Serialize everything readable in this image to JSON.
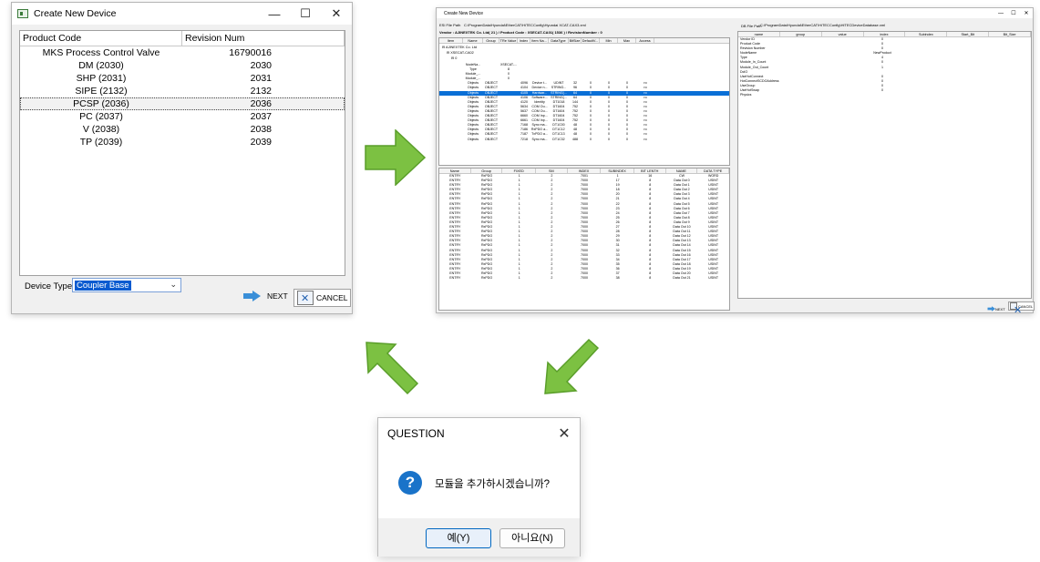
{
  "window1": {
    "title": "Create New Device",
    "columns": [
      "Product Code",
      "Revision Num"
    ],
    "rows": [
      {
        "code": "MKS Process Control Valve",
        "rev": "16790016"
      },
      {
        "code": "DM (2030)",
        "rev": "2030"
      },
      {
        "code": "SHP (2031)",
        "rev": "2031"
      },
      {
        "code": "SIPE (2132)",
        "rev": "2132"
      },
      {
        "code": "PCSP (2036)",
        "rev": "2036"
      },
      {
        "code": "PC (2037)",
        "rev": "2037"
      },
      {
        "code": "V (2038)",
        "rev": "2038"
      },
      {
        "code": "TP (2039)",
        "rev": "2039"
      }
    ],
    "selected_row": 4,
    "device_type_label": "Device Type",
    "device_type_value": "Coupler Base",
    "next_label": "NEXT",
    "cancel_label": "CANCEL"
  },
  "window2": {
    "title": "Create New Device",
    "esi_file_path_label": "ESI File Path",
    "esi_file_path": "C:\\ProgramData\\Hyundai\\EtherCAT\\HiTECConfig\\Hyundai XCAT-CAX3.xml",
    "vendor_line": "Vendor : AJINEXTEK Co. Ltd( 21 ) / Product Code : XSECAT-CA01( 1536 ) / RevisionNumber : 0",
    "tree": [
      "AJINEXTEK Co. Ltd",
      "XSECAT-CA02",
      "0"
    ],
    "grid_columns": [
      "Item",
      "Name",
      "Group",
      "TRe Value",
      "Index",
      "Item Na...",
      "DataType",
      "BitSize",
      "DefaultV...",
      "Min",
      "Max",
      "Access"
    ],
    "grid_rows": [
      [
        "",
        "NodeNa...",
        "",
        "XSECAT-...",
        "",
        "",
        "",
        "",
        "",
        "",
        "",
        ""
      ],
      [
        "",
        "Type",
        "",
        "8",
        "",
        "",
        "",
        "",
        "",
        "",
        "",
        ""
      ],
      [
        "",
        "Module_...",
        "",
        "0",
        "",
        "",
        "",
        "",
        "",
        "",
        "",
        ""
      ],
      [
        "",
        "Module_...",
        "",
        "0",
        "",
        "",
        "",
        "",
        "",
        "",
        "",
        ""
      ],
      [
        "",
        "Objects",
        "OBJECT",
        "",
        "4096",
        "Device t...",
        "UDINT",
        "32",
        "0",
        "0",
        "0",
        "ro"
      ],
      [
        "",
        "Objects",
        "OBJECT",
        "",
        "4104",
        "Device n...",
        "STRING...",
        "96",
        "0",
        "0",
        "0",
        "ro"
      ],
      [
        "",
        "Objects",
        "OBJECT",
        "",
        "4105",
        "Hardwar...",
        "STRING(...",
        "64",
        "0",
        "0",
        "0",
        "ro"
      ],
      [
        "",
        "Objects",
        "OBJECT",
        "",
        "4106",
        "Software...",
        "STRING(...",
        "64",
        "0",
        "0",
        "0",
        "ro"
      ],
      [
        "",
        "Objects",
        "OBJECT",
        "",
        "4120",
        "Identity",
        "DT1018",
        "144",
        "0",
        "0",
        "0",
        "ro"
      ],
      [
        "",
        "Objects",
        "OBJECT",
        "",
        "5634",
        "COM Ou...",
        "DT1604",
        "752",
        "0",
        "0",
        "0",
        "ro"
      ],
      [
        "",
        "Objects",
        "OBJECT",
        "",
        "5637",
        "COM Ou...",
        "DT1604",
        "752",
        "0",
        "0",
        "0",
        "ro"
      ],
      [
        "",
        "Objects",
        "OBJECT",
        "",
        "6660",
        "COM Inp...",
        "DT1604",
        "752",
        "0",
        "0",
        "0",
        "ro"
      ],
      [
        "",
        "Objects",
        "OBJECT",
        "",
        "6661",
        "COM Inp...",
        "DT1604",
        "752",
        "0",
        "0",
        "0",
        "ro"
      ],
      [
        "",
        "Objects",
        "OBJECT",
        "",
        "7168",
        "Sync ma...",
        "DT1C00",
        "48",
        "0",
        "0",
        "0",
        "ro"
      ],
      [
        "",
        "Objects",
        "OBJECT",
        "",
        "7186",
        "RxPDO a...",
        "DT1C12",
        "48",
        "0",
        "0",
        "0",
        "ro"
      ],
      [
        "",
        "Objects",
        "OBJECT",
        "",
        "7187",
        "TxPDO a...",
        "DT1C13",
        "48",
        "0",
        "0",
        "0",
        "ro"
      ],
      [
        "",
        "Objects",
        "OBJECT",
        "",
        "7218",
        "Sync ma...",
        "DT1C32",
        "488",
        "0",
        "0",
        "0",
        "ro"
      ]
    ],
    "highlight_row": 6,
    "pdo_columns": [
      "Name",
      "Group",
      "FIXED",
      "SM",
      "INDEX",
      "SUBINDEX",
      "BIT LENTH",
      "NAME",
      "DATA TYPE"
    ],
    "pdo_rows": [
      [
        "ENTRY",
        "RxPDO",
        "1",
        "2",
        "7001",
        "1",
        "16",
        "CW",
        "WORD"
      ],
      [
        "ENTRY",
        "RxPDO",
        "1",
        "2",
        "7000",
        "17",
        "8",
        "Data Out 0",
        "USINT"
      ],
      [
        "ENTRY",
        "RxPDO",
        "1",
        "2",
        "7000",
        "19",
        "8",
        "Data Out 1",
        "USINT"
      ],
      [
        "ENTRY",
        "RxPDO",
        "1",
        "2",
        "7000",
        "18",
        "8",
        "Data Out 2",
        "USINT"
      ],
      [
        "ENTRY",
        "RxPDO",
        "1",
        "2",
        "7000",
        "20",
        "8",
        "Data Out 3",
        "USINT"
      ],
      [
        "ENTRY",
        "RxPDO",
        "1",
        "2",
        "7000",
        "21",
        "8",
        "Data Out 4",
        "USINT"
      ],
      [
        "ENTRY",
        "RxPDO",
        "1",
        "2",
        "7000",
        "22",
        "8",
        "Data Out 5",
        "USINT"
      ],
      [
        "ENTRY",
        "RxPDO",
        "1",
        "2",
        "7000",
        "23",
        "8",
        "Data Out 6",
        "USINT"
      ],
      [
        "ENTRY",
        "RxPDO",
        "1",
        "2",
        "7000",
        "24",
        "8",
        "Data Out 7",
        "USINT"
      ],
      [
        "ENTRY",
        "RxPDO",
        "1",
        "2",
        "7000",
        "25",
        "8",
        "Data Out 8",
        "USINT"
      ],
      [
        "ENTRY",
        "RxPDO",
        "1",
        "2",
        "7000",
        "26",
        "8",
        "Data Out 9",
        "USINT"
      ],
      [
        "ENTRY",
        "RxPDO",
        "1",
        "2",
        "7000",
        "27",
        "8",
        "Data Out 10",
        "USINT"
      ],
      [
        "ENTRY",
        "RxPDO",
        "1",
        "2",
        "7000",
        "28",
        "8",
        "Data Out 11",
        "USINT"
      ],
      [
        "ENTRY",
        "RxPDO",
        "1",
        "2",
        "7000",
        "29",
        "8",
        "Data Out 12",
        "USINT"
      ],
      [
        "ENTRY",
        "RxPDO",
        "1",
        "2",
        "7000",
        "30",
        "8",
        "Data Out 13",
        "USINT"
      ],
      [
        "ENTRY",
        "RxPDO",
        "1",
        "2",
        "7000",
        "31",
        "8",
        "Data Out 14",
        "USINT"
      ],
      [
        "ENTRY",
        "RxPDO",
        "1",
        "2",
        "7000",
        "32",
        "8",
        "Data Out 15",
        "USINT"
      ],
      [
        "ENTRY",
        "RxPDO",
        "1",
        "2",
        "7000",
        "33",
        "8",
        "Data Out 16",
        "USINT"
      ],
      [
        "ENTRY",
        "RxPDO",
        "1",
        "2",
        "7000",
        "34",
        "8",
        "Data Out 17",
        "USINT"
      ],
      [
        "ENTRY",
        "RxPDO",
        "1",
        "2",
        "7000",
        "35",
        "8",
        "Data Out 18",
        "USINT"
      ],
      [
        "ENTRY",
        "RxPDO",
        "1",
        "2",
        "7000",
        "36",
        "8",
        "Data Out 19",
        "USINT"
      ],
      [
        "ENTRY",
        "RxPDO",
        "1",
        "2",
        "7000",
        "37",
        "8",
        "Data Out 20",
        "USINT"
      ],
      [
        "ENTRY",
        "RxPDO",
        "1",
        "2",
        "7000",
        "38",
        "8",
        "Data Out 21",
        "USINT"
      ]
    ],
    "db_file_path_label": "DB File Path",
    "db_file_path": "C:\\ProgramData\\Hyundai\\EtherCAT\\HiTECConfig\\HiTECDeviceDatabase.xml",
    "db_columns": [
      "name",
      "group",
      "value",
      "index",
      "Subindex",
      "Start_Bit",
      "Bit_Size"
    ],
    "db_rows": [
      [
        "Vendor ID",
        "",
        "0"
      ],
      [
        "Product Code",
        "",
        "0"
      ],
      [
        "Revision Number",
        "",
        "0"
      ],
      [
        "NodeName",
        "",
        "NewProduct"
      ],
      [
        "Type",
        "",
        "4"
      ],
      [
        "Module_In_Count",
        "",
        "0"
      ],
      [
        "Module_Out_Count",
        "",
        "1"
      ],
      [
        "DcIO",
        "",
        ""
      ],
      [
        "UseHotConnect",
        "",
        "0"
      ],
      [
        "HotConnectSCDOAddress",
        "",
        "0"
      ],
      [
        "UseGroup",
        "",
        "0"
      ],
      [
        "UseHotSwap",
        "",
        "0"
      ],
      [
        "Physics",
        "",
        ""
      ]
    ],
    "next_label": "NEXT",
    "cancel_label": "CANCEL"
  },
  "dialog": {
    "title": "QUESTION",
    "message": "모듈을 추가하시겠습니까?",
    "yes_label": "예(Y)",
    "no_label": "아니요(N)"
  },
  "colors": {
    "arrow_green": "#7cc142",
    "arrow_border": "#5a9e2a",
    "selection_blue": "#0a6fd6"
  }
}
